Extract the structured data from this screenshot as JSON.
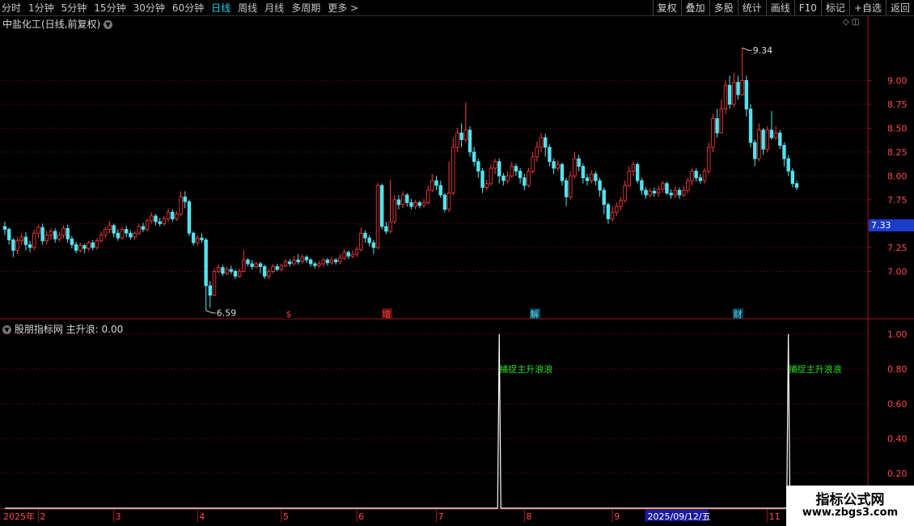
{
  "toolbar": {
    "periods": [
      "分时",
      "1分钟",
      "5分钟",
      "15分钟",
      "30分钟",
      "60分钟",
      "日线",
      "周线",
      "月线",
      "多周期",
      "更多 >"
    ],
    "active_period": "日线",
    "actions": [
      "复权",
      "叠加",
      "多股",
      "统计",
      "画线",
      "F10",
      "标记",
      "+自选",
      "返回"
    ]
  },
  "stock_title": "中盐化工(日线,前复权)",
  "indicator_title": "股朋指标网 主升浪: 0.00",
  "last_price_tag": "7.33",
  "watermark": {
    "line1": "指标公式网",
    "line2": "www.zbgs3.com"
  },
  "colors": {
    "up": "#ff3b3b",
    "down": "#54e3ee",
    "grid": "#7a1010",
    "axis": "#a01818",
    "signal_text": "#22dd22"
  },
  "chart_data": [
    {
      "type": "candlestick",
      "y_ticks": [
        7.0,
        7.25,
        7.5,
        7.75,
        8.0,
        8.25,
        8.5,
        8.75,
        9.0
      ],
      "ylim": [
        6.52,
        9.52
      ],
      "annotations": [
        {
          "text": "9.34",
          "price": 9.34,
          "kind": "high"
        },
        {
          "text": "6.59",
          "price": 6.59,
          "kind": "low"
        }
      ],
      "event_markers": [
        "$",
        "增",
        "解",
        "财"
      ],
      "candles": [
        [
          7.47,
          7.44,
          7.52,
          7.38
        ],
        [
          7.44,
          7.33,
          7.46,
          7.28
        ],
        [
          7.33,
          7.22,
          7.35,
          7.15
        ],
        [
          7.22,
          7.32,
          7.36,
          7.18
        ],
        [
          7.32,
          7.36,
          7.4,
          7.28
        ],
        [
          7.36,
          7.28,
          7.41,
          7.22
        ],
        [
          7.28,
          7.25,
          7.32,
          7.2
        ],
        [
          7.25,
          7.4,
          7.44,
          7.22
        ],
        [
          7.4,
          7.46,
          7.49,
          7.35
        ],
        [
          7.46,
          7.32,
          7.5,
          7.28
        ],
        [
          7.32,
          7.38,
          7.42,
          7.28
        ],
        [
          7.38,
          7.42,
          7.45,
          7.33
        ],
        [
          7.42,
          7.34,
          7.45,
          7.3
        ],
        [
          7.34,
          7.38,
          7.41,
          7.31
        ],
        [
          7.38,
          7.45,
          7.48,
          7.35
        ],
        [
          7.45,
          7.34,
          7.49,
          7.3
        ],
        [
          7.34,
          7.28,
          7.37,
          7.24
        ],
        [
          7.28,
          7.22,
          7.31,
          7.19
        ],
        [
          7.22,
          7.27,
          7.3,
          7.2
        ],
        [
          7.27,
          7.24,
          7.29,
          7.19
        ],
        [
          7.24,
          7.3,
          7.32,
          7.21
        ],
        [
          7.3,
          7.25,
          7.33,
          7.22
        ],
        [
          7.25,
          7.32,
          7.35,
          7.23
        ],
        [
          7.32,
          7.38,
          7.42,
          7.3
        ],
        [
          7.38,
          7.44,
          7.47,
          7.35
        ],
        [
          7.44,
          7.48,
          7.52,
          7.4
        ],
        [
          7.48,
          7.4,
          7.5,
          7.36
        ],
        [
          7.4,
          7.35,
          7.44,
          7.32
        ],
        [
          7.35,
          7.44,
          7.47,
          7.33
        ],
        [
          7.44,
          7.4,
          7.48,
          7.36
        ],
        [
          7.4,
          7.36,
          7.43,
          7.33
        ],
        [
          7.36,
          7.4,
          7.42,
          7.33
        ],
        [
          7.4,
          7.47,
          7.5,
          7.38
        ],
        [
          7.47,
          7.44,
          7.51,
          7.41
        ],
        [
          7.44,
          7.53,
          7.55,
          7.42
        ],
        [
          7.53,
          7.58,
          7.62,
          7.5
        ],
        [
          7.58,
          7.52,
          7.6,
          7.48
        ],
        [
          7.52,
          7.5,
          7.56,
          7.47
        ],
        [
          7.5,
          7.55,
          7.58,
          7.48
        ],
        [
          7.55,
          7.62,
          7.66,
          7.52
        ],
        [
          7.62,
          7.55,
          7.65,
          7.52
        ],
        [
          7.55,
          7.6,
          7.63,
          7.53
        ],
        [
          7.6,
          7.78,
          7.84,
          7.58
        ],
        [
          7.78,
          7.73,
          7.84,
          7.66
        ],
        [
          7.73,
          7.4,
          7.75,
          7.37
        ],
        [
          7.4,
          7.3,
          7.42,
          7.27
        ],
        [
          7.3,
          7.35,
          7.38,
          7.27
        ],
        [
          7.35,
          7.33,
          7.4,
          7.3
        ],
        [
          7.33,
          6.85,
          7.35,
          6.59
        ],
        [
          6.85,
          6.75,
          6.9,
          6.62
        ],
        [
          6.75,
          7.0,
          7.03,
          6.74
        ],
        [
          7.0,
          7.04,
          7.07,
          6.98
        ],
        [
          7.04,
          6.98,
          7.07,
          6.95
        ],
        [
          6.98,
          7.02,
          7.05,
          6.96
        ],
        [
          7.02,
          7.0,
          7.06,
          6.97
        ],
        [
          7.0,
          6.95,
          7.02,
          6.92
        ],
        [
          6.95,
          7.0,
          7.03,
          6.93
        ],
        [
          7.0,
          7.12,
          7.22,
          6.99
        ],
        [
          7.12,
          7.08,
          7.14,
          7.05
        ],
        [
          7.08,
          7.05,
          7.12,
          7.02
        ],
        [
          7.05,
          7.08,
          7.1,
          7.03
        ],
        [
          7.08,
          7.05,
          7.1,
          6.98
        ],
        [
          7.05,
          6.95,
          7.07,
          6.92
        ],
        [
          6.95,
          7.0,
          7.03,
          6.92
        ],
        [
          7.0,
          7.05,
          7.08,
          6.98
        ],
        [
          7.05,
          7.02,
          7.08,
          7.0
        ],
        [
          7.02,
          7.06,
          7.08,
          7.0
        ],
        [
          7.06,
          7.1,
          7.13,
          7.04
        ],
        [
          7.1,
          7.08,
          7.13,
          7.05
        ],
        [
          7.08,
          7.12,
          7.16,
          7.06
        ],
        [
          7.12,
          7.1,
          7.18,
          7.07
        ],
        [
          7.1,
          7.15,
          7.18,
          7.08
        ],
        [
          7.15,
          7.12,
          7.17,
          7.09
        ],
        [
          7.12,
          7.08,
          7.14,
          7.05
        ],
        [
          7.08,
          7.06,
          7.1,
          7.03
        ],
        [
          7.06,
          7.08,
          7.11,
          7.04
        ],
        [
          7.08,
          7.12,
          7.14,
          7.05
        ],
        [
          7.12,
          7.09,
          7.14,
          7.06
        ],
        [
          7.09,
          7.12,
          7.15,
          7.07
        ],
        [
          7.12,
          7.1,
          7.14,
          7.07
        ],
        [
          7.1,
          7.14,
          7.18,
          7.08
        ],
        [
          7.14,
          7.2,
          7.23,
          7.12
        ],
        [
          7.2,
          7.16,
          7.22,
          7.13
        ],
        [
          7.16,
          7.18,
          7.22,
          7.14
        ],
        [
          7.18,
          7.23,
          7.26,
          7.15
        ],
        [
          7.23,
          7.4,
          7.46,
          7.21
        ],
        [
          7.4,
          7.35,
          7.43,
          7.3
        ],
        [
          7.35,
          7.3,
          7.38,
          7.26
        ],
        [
          7.3,
          7.25,
          7.33,
          7.18
        ],
        [
          7.25,
          7.9,
          7.93,
          7.23
        ],
        [
          7.9,
          7.47,
          7.92,
          7.44
        ],
        [
          7.47,
          7.42,
          7.52,
          7.39
        ],
        [
          7.42,
          7.52,
          7.96,
          7.4
        ],
        [
          7.52,
          7.75,
          7.8,
          7.5
        ],
        [
          7.75,
          7.7,
          7.8,
          7.65
        ],
        [
          7.7,
          7.8,
          7.84,
          7.66
        ],
        [
          7.8,
          7.72,
          7.82,
          7.68
        ],
        [
          7.72,
          7.68,
          7.76,
          7.65
        ],
        [
          7.68,
          7.72,
          7.75,
          7.65
        ],
        [
          7.72,
          7.69,
          7.74,
          7.66
        ],
        [
          7.69,
          7.72,
          7.76,
          7.67
        ],
        [
          7.72,
          7.85,
          7.9,
          7.7
        ],
        [
          7.85,
          7.95,
          8.02,
          7.83
        ],
        [
          7.95,
          7.9,
          8.0,
          7.85
        ],
        [
          7.9,
          7.8,
          7.95,
          7.77
        ],
        [
          7.8,
          7.65,
          7.82,
          7.62
        ],
        [
          7.65,
          7.82,
          8.15,
          7.62
        ],
        [
          7.82,
          8.3,
          8.4,
          7.8
        ],
        [
          8.3,
          8.45,
          8.5,
          8.25
        ],
        [
          8.45,
          8.38,
          8.55,
          8.3
        ],
        [
          8.38,
          8.48,
          8.77,
          8.35
        ],
        [
          8.48,
          8.25,
          8.52,
          8.2
        ],
        [
          8.25,
          8.15,
          8.3,
          8.1
        ],
        [
          8.15,
          8.05,
          8.18,
          7.98
        ],
        [
          8.05,
          7.88,
          8.08,
          7.82
        ],
        [
          7.88,
          7.92,
          7.96,
          7.85
        ],
        [
          7.92,
          8.08,
          8.12,
          7.9
        ],
        [
          8.08,
          8.15,
          8.18,
          8.02
        ],
        [
          8.15,
          8.0,
          8.18,
          7.92
        ],
        [
          8.0,
          7.95,
          8.03,
          7.9
        ],
        [
          7.95,
          8.0,
          8.05,
          7.92
        ],
        [
          8.0,
          8.1,
          8.15,
          7.98
        ],
        [
          8.1,
          8.05,
          8.13,
          8.0
        ],
        [
          8.05,
          7.98,
          8.08,
          7.92
        ],
        [
          7.98,
          7.9,
          8.02,
          7.85
        ],
        [
          7.9,
          8.05,
          8.08,
          7.88
        ],
        [
          8.05,
          8.2,
          8.25,
          8.02
        ],
        [
          8.2,
          8.3,
          8.36,
          8.15
        ],
        [
          8.3,
          8.4,
          8.45,
          8.25
        ],
        [
          8.4,
          8.3,
          8.44,
          8.2
        ],
        [
          8.3,
          8.15,
          8.33,
          8.1
        ],
        [
          8.15,
          8.08,
          8.18,
          8.02
        ],
        [
          8.08,
          8.12,
          8.16,
          8.05
        ],
        [
          8.12,
          7.95,
          8.14,
          7.9
        ],
        [
          7.95,
          7.78,
          7.98,
          7.68
        ],
        [
          7.78,
          8.0,
          8.05,
          7.75
        ],
        [
          8.0,
          8.18,
          8.25,
          7.97
        ],
        [
          8.18,
          8.1,
          8.22,
          8.05
        ],
        [
          8.1,
          7.98,
          8.13,
          7.92
        ],
        [
          7.98,
          7.95,
          8.02,
          7.9
        ],
        [
          7.95,
          8.02,
          8.06,
          7.92
        ],
        [
          8.02,
          7.95,
          8.05,
          7.9
        ],
        [
          7.95,
          7.85,
          7.98,
          7.78
        ],
        [
          7.85,
          7.7,
          7.88,
          7.6
        ],
        [
          7.7,
          7.55,
          7.72,
          7.5
        ],
        [
          7.55,
          7.62,
          7.68,
          7.52
        ],
        [
          7.62,
          7.68,
          7.72,
          7.58
        ],
        [
          7.68,
          7.74,
          7.78,
          7.64
        ],
        [
          7.74,
          7.9,
          7.95,
          7.72
        ],
        [
          7.9,
          8.05,
          8.1,
          7.88
        ],
        [
          8.05,
          8.12,
          8.15,
          8.0
        ],
        [
          8.12,
          7.95,
          8.14,
          7.92
        ],
        [
          7.95,
          7.85,
          7.98,
          7.8
        ],
        [
          7.85,
          7.8,
          7.88,
          7.76
        ],
        [
          7.8,
          7.84,
          7.87,
          7.77
        ],
        [
          7.84,
          7.82,
          7.88,
          7.78
        ],
        [
          7.82,
          7.86,
          7.9,
          7.78
        ],
        [
          7.86,
          7.92,
          7.95,
          7.82
        ],
        [
          7.92,
          7.82,
          7.94,
          7.8
        ],
        [
          7.82,
          7.8,
          7.86,
          7.76
        ],
        [
          7.8,
          7.85,
          7.89,
          7.77
        ],
        [
          7.85,
          7.8,
          7.88,
          7.76
        ],
        [
          7.8,
          7.85,
          7.9,
          7.78
        ],
        [
          7.85,
          7.95,
          7.98,
          7.82
        ],
        [
          7.95,
          8.05,
          8.08,
          7.9
        ],
        [
          8.05,
          7.98,
          8.08,
          7.94
        ],
        [
          7.98,
          7.95,
          8.02,
          7.92
        ],
        [
          7.95,
          8.05,
          8.08,
          7.92
        ],
        [
          8.05,
          8.3,
          8.35,
          8.02
        ],
        [
          8.3,
          8.6,
          8.65,
          8.25
        ],
        [
          8.6,
          8.45,
          8.7,
          8.4
        ],
        [
          8.45,
          8.7,
          8.8,
          8.45
        ],
        [
          8.7,
          8.95,
          9.0,
          8.65
        ],
        [
          8.95,
          8.75,
          9.05,
          8.7
        ],
        [
          8.75,
          8.98,
          9.08,
          8.72
        ],
        [
          8.98,
          8.85,
          9.05,
          8.8
        ],
        [
          8.85,
          9.0,
          9.34,
          8.84
        ],
        [
          9.0,
          8.7,
          9.05,
          8.62
        ],
        [
          8.7,
          8.35,
          8.75,
          8.3
        ],
        [
          8.35,
          8.18,
          8.38,
          8.1
        ],
        [
          8.18,
          8.48,
          8.55,
          8.15
        ],
        [
          8.48,
          8.28,
          8.5,
          8.22
        ],
        [
          8.28,
          8.48,
          8.52,
          8.25
        ],
        [
          8.48,
          8.4,
          8.68,
          8.38
        ],
        [
          8.4,
          8.45,
          8.52,
          8.38
        ],
        [
          8.45,
          8.32,
          8.48,
          8.28
        ],
        [
          8.32,
          8.18,
          8.35,
          8.1
        ],
        [
          8.18,
          8.05,
          8.22,
          8.0
        ],
        [
          8.05,
          7.92,
          8.08,
          7.88
        ],
        [
          7.92,
          7.88,
          7.95,
          7.85
        ]
      ]
    },
    {
      "type": "line",
      "name": "主升浪",
      "y_ticks": [
        0.2,
        0.4,
        0.6,
        0.8,
        1.0
      ],
      "ylim": [
        0,
        1.05
      ],
      "signals": [
        {
          "candle_index": 118,
          "value": 1,
          "label": "捕捉主升浪浪"
        },
        {
          "candle_index": 187,
          "value": 1,
          "label": "捕捉主升浪浪"
        }
      ]
    }
  ],
  "x_axis": {
    "labels": [
      {
        "text": "2025年",
        "candle_index": 0
      },
      {
        "text": "2",
        "candle_index": 8
      },
      {
        "text": "3",
        "candle_index": 26
      },
      {
        "text": "4",
        "candle_index": 46
      },
      {
        "text": "5",
        "candle_index": 66
      },
      {
        "text": "6",
        "candle_index": 84
      },
      {
        "text": "7",
        "candle_index": 103
      },
      {
        "text": "8",
        "candle_index": 124
      },
      {
        "text": "9",
        "candle_index": 145
      },
      {
        "text": "2025/09/12/五",
        "candle_index": 153,
        "highlight": true
      },
      {
        "text": "11",
        "candle_index": 182
      }
    ]
  }
}
